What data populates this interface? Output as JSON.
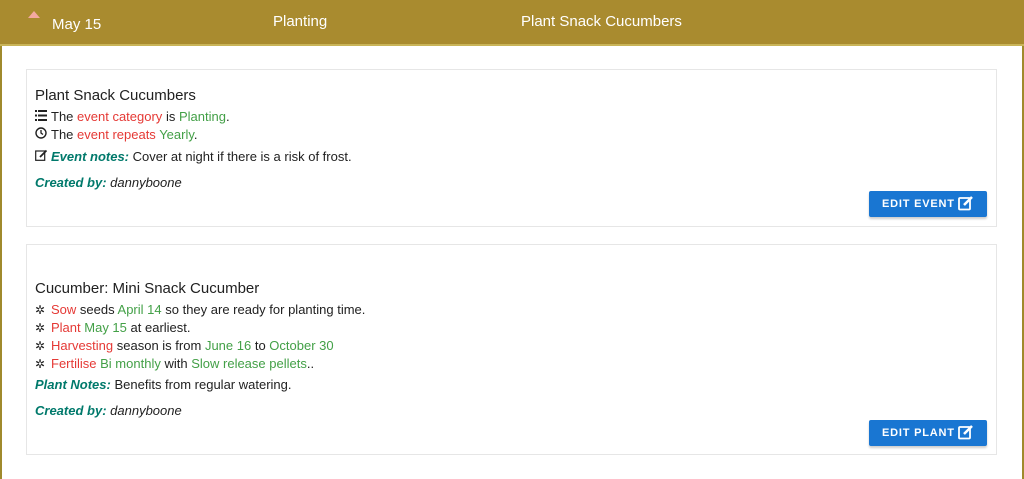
{
  "header": {
    "date": "May 15",
    "category": "Planting",
    "title": "Plant Snack Cucumbers"
  },
  "event_card": {
    "title": "Plant Snack Cucumbers",
    "category_line": {
      "prefix": "The",
      "term": "event category",
      "mid": "is",
      "value": "Planting",
      "end": "."
    },
    "repeat_line": {
      "prefix": "The",
      "term": "event repeats",
      "value": "Yearly",
      "end": "."
    },
    "notes_label": "Event notes:",
    "notes_text": "Cover at night if there is a risk of frost.",
    "created_label": "Created by:",
    "created_by": "dannyboone",
    "button_label": "EDIT EVENT"
  },
  "plant_card": {
    "title": "Cucumber: Mini Snack Cucumber",
    "sow": {
      "term": "Sow",
      "a": "seeds",
      "date": "April 14",
      "b": "so they are ready for planting time."
    },
    "plant": {
      "term": "Plant",
      "date": "May 15",
      "b": "at earliest."
    },
    "harvest": {
      "term": "Harvesting",
      "a": "season is from",
      "from": "June 16",
      "to_word": "to",
      "to": "October 30"
    },
    "fertilise": {
      "term": "Fertilise",
      "freq": "Bi monthly",
      "with": "with",
      "product": "Slow release pellets",
      "end": ".."
    },
    "notes_label": "Plant Notes:",
    "notes_text": "Benefits from regular watering.",
    "created_label": "Created by:",
    "created_by": "dannyboone",
    "button_label": "EDIT PLANT"
  },
  "colors": {
    "header": "#a98b2f",
    "button": "#1976d2",
    "term": "#e53935",
    "value": "#43a047",
    "label": "#00796b"
  },
  "icons": [
    "caret-up-icon",
    "list-icon",
    "clock-icon",
    "edit-icon",
    "gear-icon"
  ]
}
